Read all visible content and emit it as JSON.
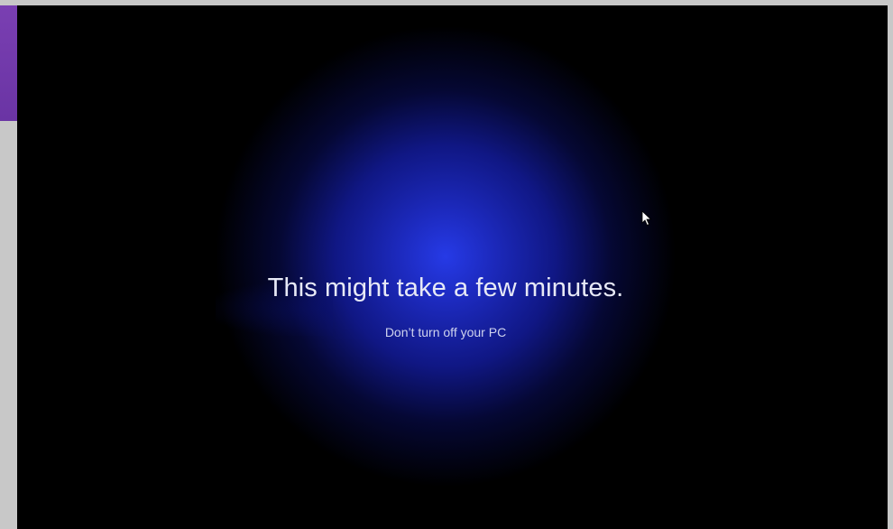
{
  "setup_screen": {
    "title": "This might take a few minutes.",
    "subtitle": "Don’t turn off your PC"
  },
  "colors": {
    "screen_background": "#000000",
    "glow_center": "#263ae6",
    "window_border": "#c8c8c8",
    "side_accent": "#7a3fb2",
    "text": "#e7e9f6"
  },
  "icons": {
    "cursor": "mouse-pointer-arrow"
  }
}
